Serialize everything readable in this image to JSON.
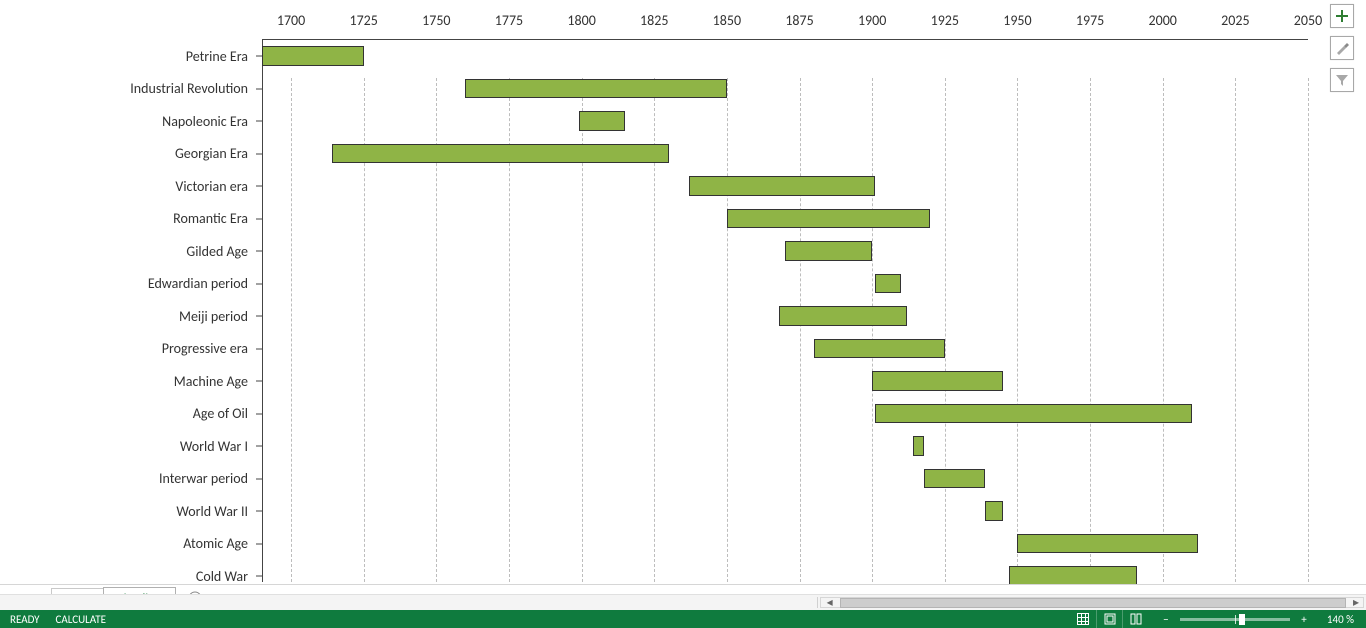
{
  "chart_data": {
    "type": "bar",
    "orientation": "horizontal-range",
    "xlabel": "",
    "ylabel": "",
    "xlim": [
      1690,
      2050
    ],
    "xticks": [
      1700,
      1725,
      1750,
      1775,
      1800,
      1825,
      1850,
      1875,
      1900,
      1925,
      1950,
      1975,
      2000,
      2025,
      2050
    ],
    "series": [
      {
        "name": "Petrine Era",
        "start": 1690,
        "end": 1725
      },
      {
        "name": "Industrial Revolution",
        "start": 1760,
        "end": 1850
      },
      {
        "name": "Napoleonic Era",
        "start": 1799,
        "end": 1815
      },
      {
        "name": "Georgian Era",
        "start": 1714,
        "end": 1830
      },
      {
        "name": "Victorian era",
        "start": 1837,
        "end": 1901
      },
      {
        "name": "Romantic Era",
        "start": 1850,
        "end": 1920
      },
      {
        "name": "Gilded Age",
        "start": 1870,
        "end": 1900
      },
      {
        "name": "Edwardian period",
        "start": 1901,
        "end": 1910
      },
      {
        "name": "Meiji period",
        "start": 1868,
        "end": 1912
      },
      {
        "name": "Progressive era",
        "start": 1880,
        "end": 1925
      },
      {
        "name": "Machine Age",
        "start": 1900,
        "end": 1945
      },
      {
        "name": "Age of Oil",
        "start": 1901,
        "end": 2010
      },
      {
        "name": "World War I",
        "start": 1914,
        "end": 1918
      },
      {
        "name": "Interwar period",
        "start": 1918,
        "end": 1939
      },
      {
        "name": "World War II",
        "start": 1939,
        "end": 1945
      },
      {
        "name": "Atomic Age",
        "start": 1950,
        "end": 2012
      },
      {
        "name": "Cold War",
        "start": 1947,
        "end": 1991
      }
    ],
    "bar_color": "#8fb446"
  },
  "sheets": {
    "tabs": [
      {
        "label": "Data",
        "active": false
      },
      {
        "label": "Timeline",
        "active": true
      }
    ]
  },
  "statusbar": {
    "ready": "READY",
    "calculate": "CALCULATE",
    "zoom_label": "140 %",
    "zoom_value": 140
  },
  "chart_tools": {
    "plus": "chart-elements",
    "brush": "chart-styles",
    "filter": "chart-filter"
  }
}
